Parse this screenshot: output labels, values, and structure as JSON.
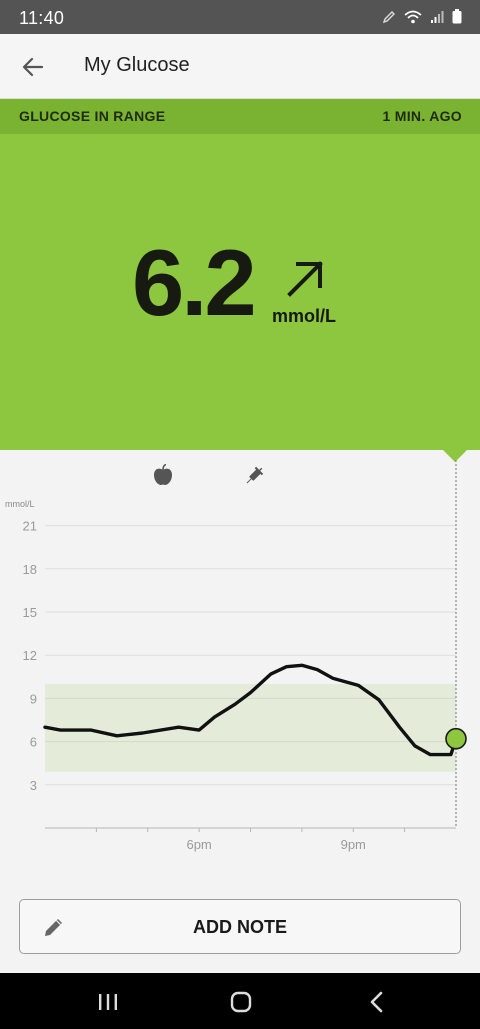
{
  "status_bar": {
    "time": "11:40",
    "icons": [
      "pencil-icon",
      "wifi-icon",
      "signal-icon",
      "battery-icon"
    ]
  },
  "app_bar": {
    "title": "My Glucose",
    "back_icon": "arrow-left-icon"
  },
  "range_strip": {
    "status": "GLUCOSE IN RANGE",
    "updated": "1 MIN. AGO",
    "color": "#7ab332"
  },
  "reading": {
    "value": "6.2",
    "unit": "mmol/L",
    "trend_icon": "arrow-up-right-icon",
    "panel_color": "#8dc63f"
  },
  "chart": {
    "event_icons": [
      "apple-icon",
      "syringe-icon"
    ],
    "unit_label": "mmol/L",
    "y_ticks": [
      "21",
      "18",
      "15",
      "12",
      "9",
      "6",
      "3"
    ],
    "x_ticks": [
      "6pm",
      "9pm"
    ]
  },
  "chart_data": {
    "type": "line",
    "ylabel": "mmol/L",
    "ylim": [
      0,
      21
    ],
    "y_ticks": [
      3,
      6,
      9,
      12,
      15,
      18,
      21
    ],
    "target_range": [
      3.9,
      10.0
    ],
    "x_tick_labels": [
      "6pm",
      "9pm"
    ],
    "x_hours": [
      15.0,
      23.0
    ],
    "series": [
      {
        "x": [
          15.0,
          15.3,
          15.9,
          16.4,
          16.9,
          17.6,
          18.0,
          18.3,
          18.7,
          19.0,
          19.4,
          19.7,
          20.0,
          20.3,
          20.6,
          21.1,
          21.5,
          21.9,
          22.2,
          22.5,
          22.9,
          23.0
        ],
        "y": [
          7.0,
          6.8,
          6.8,
          6.4,
          6.6,
          7.0,
          6.8,
          7.7,
          8.6,
          9.4,
          10.7,
          11.2,
          11.3,
          11.0,
          10.4,
          9.9,
          8.9,
          7.0,
          5.7,
          5.1,
          5.1,
          6.2
        ]
      }
    ],
    "current": {
      "value": 6.2,
      "unit": "mmol/L"
    },
    "grid": true
  },
  "add_note": {
    "label": "ADD NOTE",
    "icon": "pencil-icon"
  },
  "nav_bar": {
    "items": [
      "recents-icon",
      "home-icon",
      "back-icon"
    ]
  }
}
